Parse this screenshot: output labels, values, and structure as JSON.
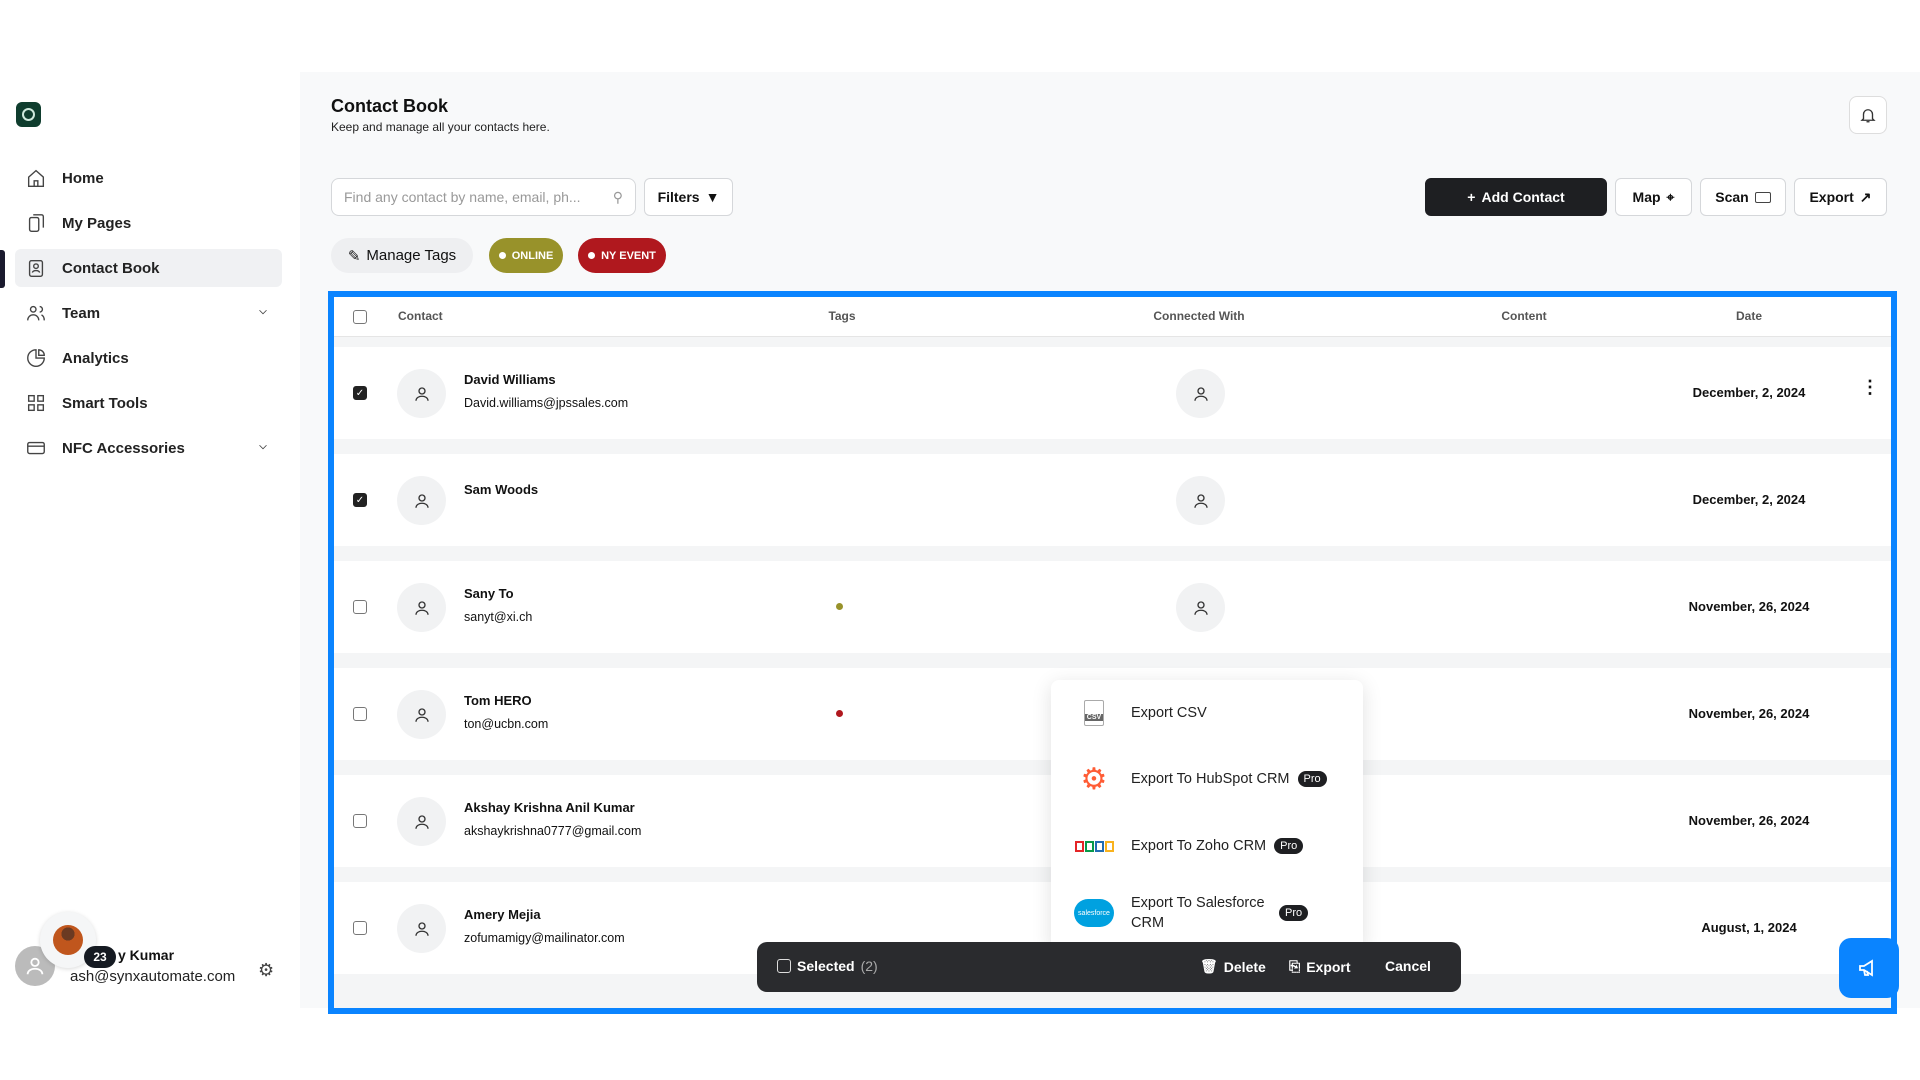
{
  "sidebar": {
    "items": [
      {
        "label": "Home",
        "icon": "home-icon"
      },
      {
        "label": "My Pages",
        "icon": "pages-icon"
      },
      {
        "label": "Contact Book",
        "icon": "contact-book-icon",
        "active": true
      },
      {
        "label": "Team",
        "icon": "team-icon",
        "expandable": true
      },
      {
        "label": "Analytics",
        "icon": "analytics-icon"
      },
      {
        "label": "Smart Tools",
        "icon": "grid-icon"
      },
      {
        "label": "NFC Accessories",
        "icon": "card-icon",
        "expandable": true
      }
    ],
    "user": {
      "name": "y Kumar",
      "email": "ash@synxautomate.com",
      "badge": "23"
    }
  },
  "header": {
    "title": "Contact Book",
    "subtitle": "Keep and manage all your contacts here."
  },
  "toolbar": {
    "search_placeholder": "Find any contact by name, email, ph...",
    "filters": "Filters",
    "add_contact": "Add Contact",
    "map": "Map",
    "scan": "Scan",
    "export": "Export"
  },
  "tags": {
    "manage": "Manage Tags",
    "items": [
      {
        "label": "ONLINE",
        "color": "#98922a"
      },
      {
        "label": "NY EVENT",
        "color": "#b0181e"
      }
    ]
  },
  "table": {
    "columns": [
      "Contact",
      "Tags",
      "Connected With",
      "Content",
      "Date"
    ],
    "rows": [
      {
        "name": "David Williams",
        "email": "David.williams@jpssales.com",
        "tag": null,
        "date": "December, 2, 2024",
        "checked": true
      },
      {
        "name": "Sam Woods",
        "email": "",
        "tag": null,
        "date": "December, 2, 2024",
        "checked": true
      },
      {
        "name": "Sany To",
        "email": "sanyt@xi.ch",
        "tag": "#98922a",
        "date": "November, 26, 2024",
        "checked": false
      },
      {
        "name": "Tom HERO",
        "email": "ton@ucbn.com",
        "tag": "#b0181e",
        "date": "November, 26, 2024",
        "checked": false
      },
      {
        "name": "Akshay Krishna Anil Kumar",
        "email": "akshaykrishna0777@gmail.com",
        "tag": null,
        "date": "November, 26, 2024",
        "checked": false
      },
      {
        "name": "Amery Mejia",
        "email": "zofumamigy@mailinator.com",
        "tag": null,
        "date": "August, 1, 2024",
        "checked": false
      }
    ]
  },
  "export_menu": {
    "items": [
      {
        "label": "Export CSV"
      },
      {
        "label": "Export To HubSpot CRM",
        "badge": "Pro"
      },
      {
        "label": "Export To Zoho CRM",
        "badge": "Pro"
      },
      {
        "label": "Export To Salesforce CRM",
        "badge": "Pro"
      }
    ]
  },
  "selection_bar": {
    "selected": "Selected",
    "count": "(2)",
    "delete": "Delete",
    "export": "Export",
    "cancel": "Cancel"
  },
  "colors": {
    "accent": "#0a84ff",
    "dark": "#1e1f22"
  }
}
